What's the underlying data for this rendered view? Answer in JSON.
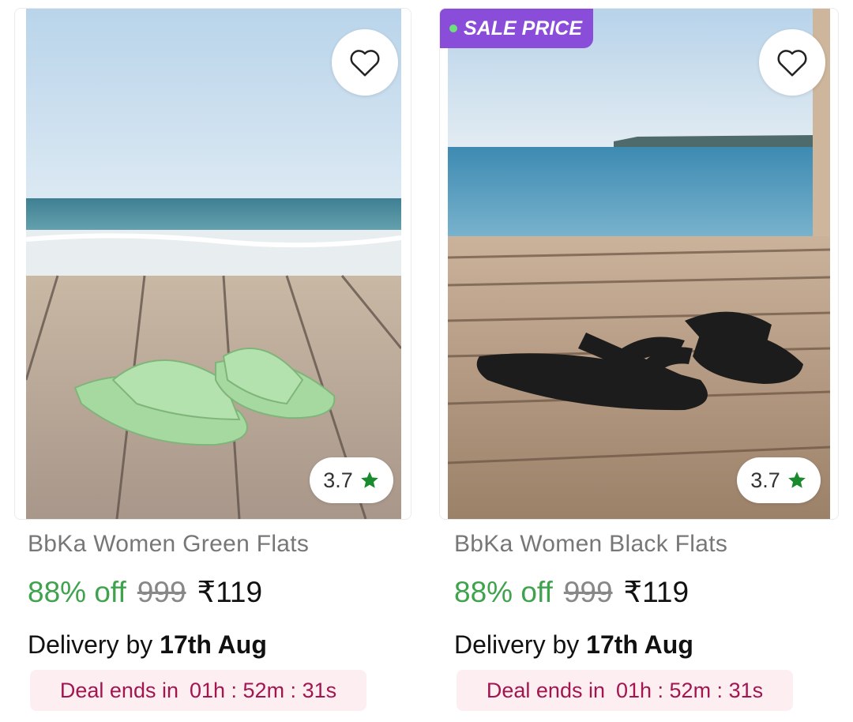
{
  "products": [
    {
      "name": "BbKa Women Green Flats",
      "discount": "88% off",
      "mrp": "999",
      "price": "₹119",
      "rating": "3.7",
      "delivery_prefix": "Delivery by",
      "delivery_date": "17th Aug",
      "deal_label": "Deal ends in",
      "deal_timer": "01h : 52m : 31s",
      "badge": "",
      "sandal_color": "#a6d9a0"
    },
    {
      "name": "BbKa Women Black Flats",
      "discount": "88% off",
      "mrp": "999",
      "price": "₹119",
      "rating": "3.7",
      "delivery_prefix": "Delivery by",
      "delivery_date": "17th Aug",
      "deal_label": "Deal ends in",
      "deal_timer": "01h : 52m : 31s",
      "badge": "SALE PRICE",
      "sandal_color": "#1c1c1c"
    }
  ],
  "icons": {
    "wishlist": "heart-outline-icon",
    "rating": "star-icon"
  },
  "colors": {
    "discount": "#3fa34d",
    "rating_star": "#1a8a2e",
    "deal_text": "#a3154f",
    "deal_bg": "#fdeff1",
    "sale_badge": "#8a4dd9"
  }
}
